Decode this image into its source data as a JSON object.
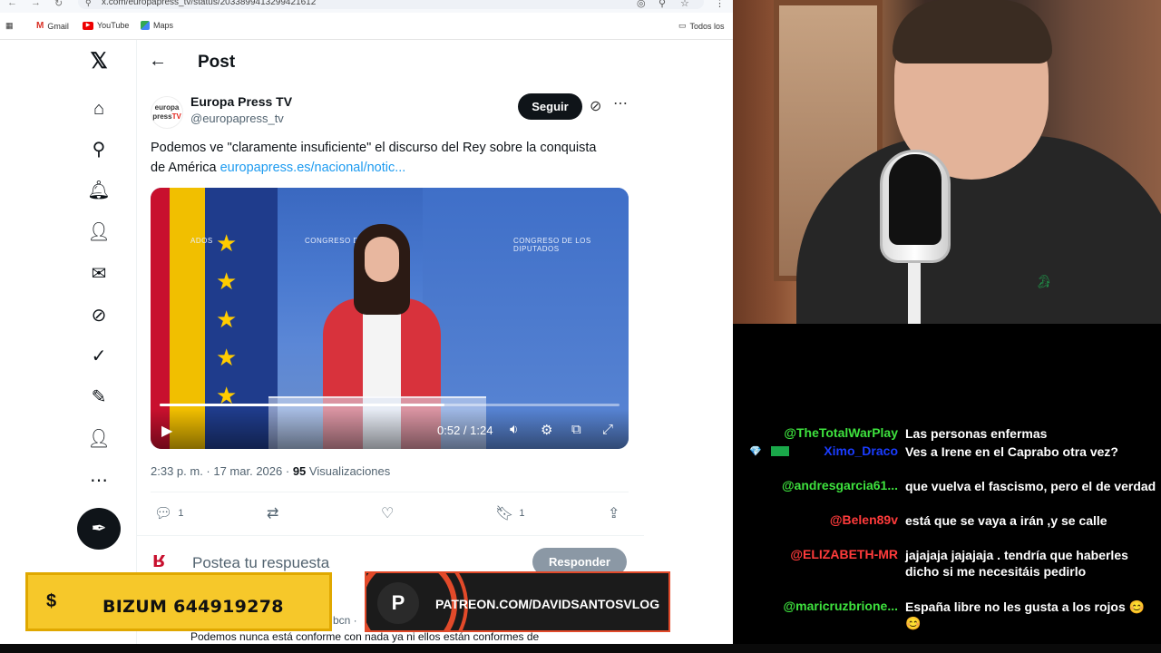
{
  "browser": {
    "url": "x.com/europapress_tv/status/2033899413299421612",
    "bookmarks": [
      "Gmail",
      "YouTube",
      "Maps"
    ],
    "all_bookmarks": "Todos los"
  },
  "post": {
    "header_title": "Post",
    "author_name": "Europa Press TV",
    "author_handle": "@europapress_tv",
    "avatar_text_1": "europa",
    "avatar_text_2": "press",
    "avatar_text_3": "TV",
    "follow_label": "Seguir",
    "text": "Podemos ve \"claramente insuficiente\" el discurso del Rey sobre la conquista de América",
    "link": "europapress.es/nacional/notic...",
    "video": {
      "time": "0:52 / 1:24",
      "progress": 0.62,
      "banner_left": "CONGRESO DE",
      "banner_right": "CONGRESO DE LOS DIPUTADOS",
      "banner_far_left": "ADOS"
    },
    "meta_time": "2:33 p. m. · 17 mar. 2026 · ",
    "views_count": "95",
    "views_label": " Visualizaciones",
    "replies_count": "1",
    "bookmarks_count": "1",
    "reply_placeholder": "Postea tu respuesta",
    "reply_button": "Responder",
    "next_handle": "bcn ·",
    "next_text": "Podemos nunca está conforme con nada ya ni ellos están conformes de"
  },
  "overlays": {
    "bizum_symbol": "$",
    "bizum_text": "BIZUM 644919278",
    "patreon_text": "PATREON.COM/DAVIDSANTOSVLOG"
  },
  "chat": [
    {
      "user": "@TheTotalWarPlay",
      "color": "#3ee23e",
      "message": "Las personas enfermas"
    },
    {
      "user": "Ximo_Draco",
      "color": "#1a3cff",
      "message": "Ves a Irene en el Caprabo otra vez?"
    },
    {
      "user": "@andresgarcia61...",
      "color": "#3ee23e",
      "message": "que vuelva el fascismo, pero el de verdad"
    },
    {
      "user": "@Belen89v",
      "color": "#ff3b3b",
      "message": "está que se vaya a irán ,y se calle"
    },
    {
      "user": "@ELIZABETH-MR",
      "color": "#ff3b3b",
      "message": "jajajaja jajajaja . tendría que haberles dicho si me necesitáis pedirlo"
    },
    {
      "user": "@maricruzbrione...",
      "color": "#3ee23e",
      "message": "España libre no les gusta a los rojos 😊 😊"
    }
  ]
}
